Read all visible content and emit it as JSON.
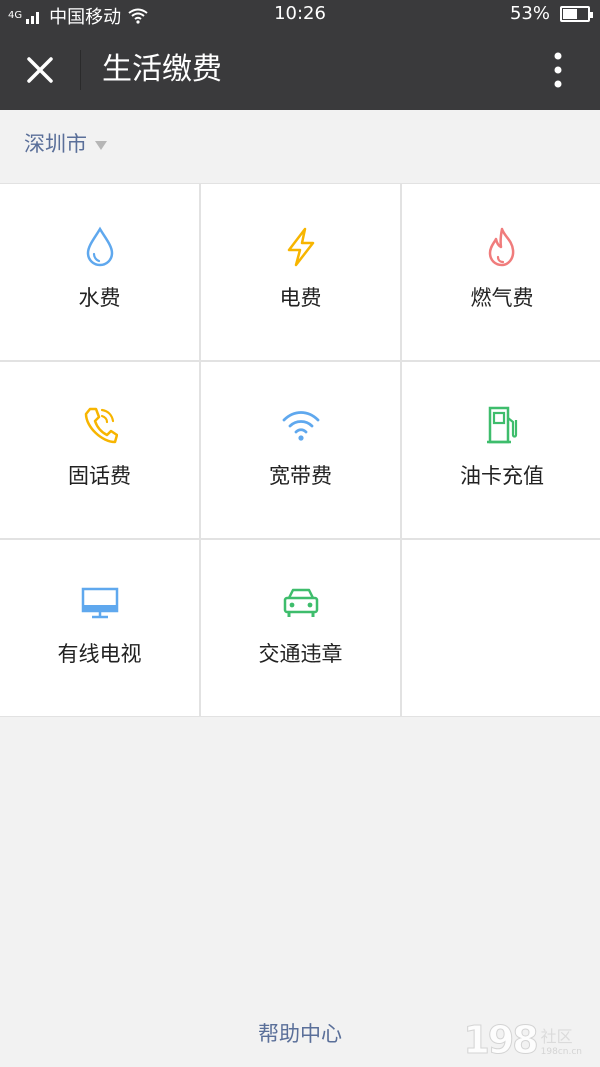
{
  "status_bar": {
    "network_label": "4G",
    "carrier": "中国移动",
    "time": "10:26",
    "battery_percent": "53%",
    "battery_level": 0.53
  },
  "header": {
    "title": "生活缴费",
    "close_icon": "close-icon",
    "more_icon": "more-vertical-icon"
  },
  "city_selector": {
    "city": "深圳市"
  },
  "services": [
    {
      "label": "水费",
      "icon": "water-drop-icon",
      "color": "#5fa8ee"
    },
    {
      "label": "电费",
      "icon": "lightning-icon",
      "color": "#f7b500"
    },
    {
      "label": "燃气费",
      "icon": "flame-icon",
      "color": "#f07c7c"
    },
    {
      "label": "固话费",
      "icon": "phone-icon",
      "color": "#f7b500"
    },
    {
      "label": "宽带费",
      "icon": "wifi-icon",
      "color": "#5fa8ee"
    },
    {
      "label": "油卡充值",
      "icon": "fuel-pump-icon",
      "color": "#3ebd6c"
    },
    {
      "label": "有线电视",
      "icon": "tv-icon",
      "color": "#5fa8ee"
    },
    {
      "label": "交通违章",
      "icon": "car-icon",
      "color": "#3ebd6c"
    }
  ],
  "footer": {
    "help_link": "帮助中心"
  },
  "watermark": {
    "number": "198",
    "text": "社区",
    "subtext": "198cn.cn"
  }
}
